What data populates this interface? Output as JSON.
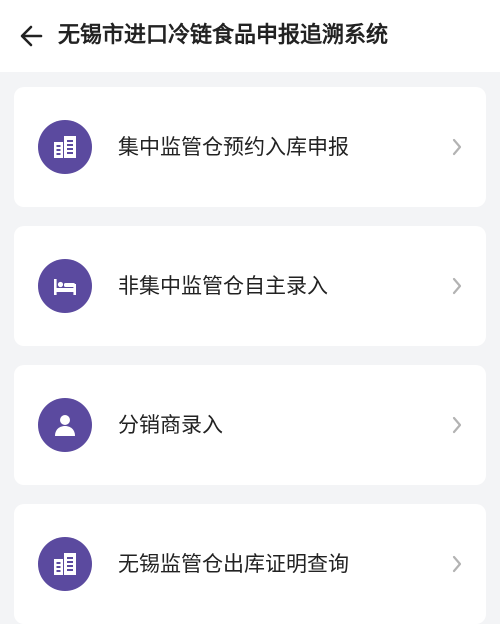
{
  "header": {
    "title": "无锡市进口冷链食品申报追溯系统"
  },
  "menu": {
    "items": [
      {
        "label": "集中监管仓预约入库申报",
        "icon": "building-icon"
      },
      {
        "label": "非集中监管仓自主录入",
        "icon": "bed-icon"
      },
      {
        "label": "分销商录入",
        "icon": "user-icon"
      },
      {
        "label": "无锡监管仓出库证明查询",
        "icon": "building-icon"
      }
    ]
  },
  "colors": {
    "icon_background": "#5b4a9f",
    "page_background": "#f3f4f6",
    "card_background": "#ffffff",
    "chevron": "#b3b3b3"
  }
}
